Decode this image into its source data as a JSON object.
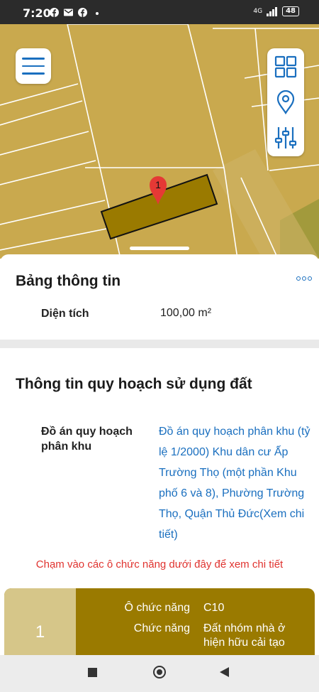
{
  "status_bar": {
    "time": "7:20",
    "network": "4G",
    "battery": "48",
    "icons": [
      "facebook-icon",
      "mail-icon",
      "facebook-icon",
      "signal-icon",
      "battery-icon"
    ]
  },
  "map": {
    "parcel_marker": "1",
    "colors": {
      "land": "#c9a94e",
      "parcel": "#9a7a00",
      "marker": "#e53935"
    }
  },
  "map_tools": [
    "layers-grid-icon",
    "location-pin-icon",
    "filter-sliders-icon"
  ],
  "info_panel": {
    "title": "Bảng thông tin",
    "area_label": "Diện tích",
    "area_value": "100,00 m²"
  },
  "planning": {
    "title": "Thông tin quy hoạch sử dụng đất",
    "plan_label": "Đồ án quy hoạch phân khu",
    "plan_value": "Đồ án quy hoạch phân khu (tỷ lệ 1/2000) Khu dân cư Ấp Trường Thọ (một phần Khu phố 6 và 8), Phường Trường Thọ, Quận Thủ Đức(Xem chi tiết)"
  },
  "hint": "Chạm vào các ô chức năng dưới đây để xem chi tiết",
  "function_card": {
    "number": "1",
    "rows": [
      {
        "label": "Ô chức năng",
        "value": "C10"
      },
      {
        "label": "Chức năng",
        "value": "Đất nhóm nhà ở hiện hữu cải tạo"
      }
    ],
    "colors": {
      "left": "#d6c689",
      "right": "#9a7a00"
    }
  },
  "accent_color": "#1a6fbf",
  "hint_color": "#e0332f"
}
